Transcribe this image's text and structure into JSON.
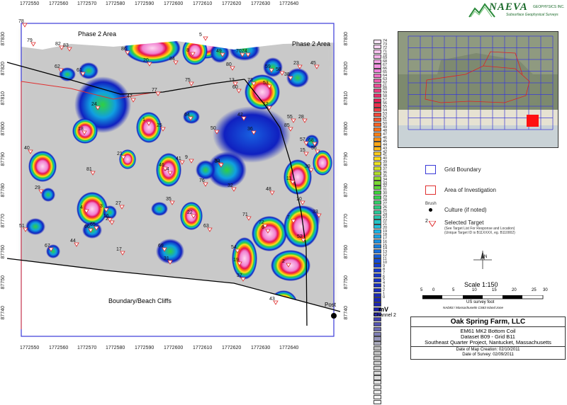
{
  "map": {
    "x_ticks": [
      "1772550",
      "1772560",
      "1772570",
      "1772580",
      "1772590",
      "1772600",
      "1772610",
      "1772620",
      "1772630",
      "1772640"
    ],
    "y_ticks": [
      "87830",
      "87820",
      "87810",
      "87800",
      "87790",
      "87780",
      "87770",
      "87760",
      "87750",
      "87740"
    ],
    "area_labels": {
      "phase2_left": "Phase 2 Area",
      "phase2_right": "Phase 2 Area",
      "boundary": "Boundary/Beach Cliffs",
      "post": "Post"
    },
    "targets": [
      "78",
      "79",
      "82",
      "83",
      "86",
      "29",
      "20",
      "84",
      "8",
      "5",
      "49",
      "70",
      "74",
      "62",
      "61",
      "77",
      "47",
      "75",
      "80",
      "59",
      "58",
      "60",
      "73",
      "53",
      "1",
      "25",
      "24",
      "26",
      "64",
      "30",
      "21",
      "81",
      "18",
      "3",
      "39",
      "31",
      "14",
      "27",
      "46",
      "2",
      "15",
      "11",
      "10",
      "33",
      "4",
      "66",
      "65",
      "35",
      "22",
      "67",
      "71",
      "48",
      "69",
      "72",
      "44",
      "37",
      "50",
      "12",
      "55",
      "54",
      "57",
      "56",
      "45",
      "38",
      "52",
      "7",
      "6",
      "9",
      "13",
      "63",
      "41",
      "43",
      "23",
      "28",
      "42",
      "36",
      "19",
      "34",
      "32",
      "68",
      "17",
      "16",
      "40",
      "51",
      "76",
      "85"
    ],
    "colors": {
      "frame": "#3a3ad8",
      "boundary": "#000000",
      "area": "#e03030"
    }
  },
  "colorbar": {
    "values": [
      "74",
      "73",
      "72",
      "71",
      "70",
      "69",
      "68",
      "67",
      "66",
      "65",
      "64",
      "63",
      "62",
      "61",
      "60",
      "59",
      "58",
      "57",
      "56",
      "55",
      "54",
      "53",
      "52",
      "51",
      "50",
      "49",
      "48",
      "47",
      "46",
      "45",
      "44",
      "43",
      "42",
      "41",
      "40",
      "39",
      "38",
      "37",
      "36",
      "35",
      "34",
      "33",
      "32",
      "31",
      "30",
      "29",
      "28",
      "27",
      "26",
      "25",
      "24",
      "23",
      "22",
      "21",
      "20",
      "19",
      "18",
      "17",
      "16",
      "15",
      "14",
      "13",
      "12",
      "11",
      "10",
      "9",
      "8",
      "7",
      "6",
      "5",
      "4",
      "3",
      "2",
      "1",
      "0"
    ],
    "unit": "mV",
    "channel": "Channel 2"
  },
  "logo": {
    "name": "NAEVA",
    "suffix": "GEOPHYSICS INC.",
    "tagline": "Subsurface Geophysical Surveys"
  },
  "legend": {
    "grid_boundary": "Grid Boundary",
    "area_investigation": "Area of Investigation",
    "brush": "Brush",
    "culture": "Culture (if noted)",
    "target_num": "2",
    "selected_target": "Selected Target",
    "selected_note1": "(See Target List For Response and Location)",
    "selected_note2": "(Unique Target ID is B11XXXX, eg. B110002)"
  },
  "scale": {
    "title": "Scale 1:150",
    "ticks": [
      "5",
      "0",
      "5",
      "10",
      "15",
      "20",
      "25",
      "30"
    ],
    "units": "US survey foot",
    "datum": "NAD83 / Massachusetts CS83 Island zone"
  },
  "titleblock": {
    "client": "Oak Spring Farm, LLC",
    "line1": "EM61 MK2 Bottom Coil",
    "line2": "Dataset B09 - Grid B11",
    "line3": "Southeast Quarter Project, Nantucket, Massachusetts",
    "date_creation": "Date of Map Creation: 02/10/2011",
    "date_survey": "Date of Survey: 02/09/2011"
  }
}
